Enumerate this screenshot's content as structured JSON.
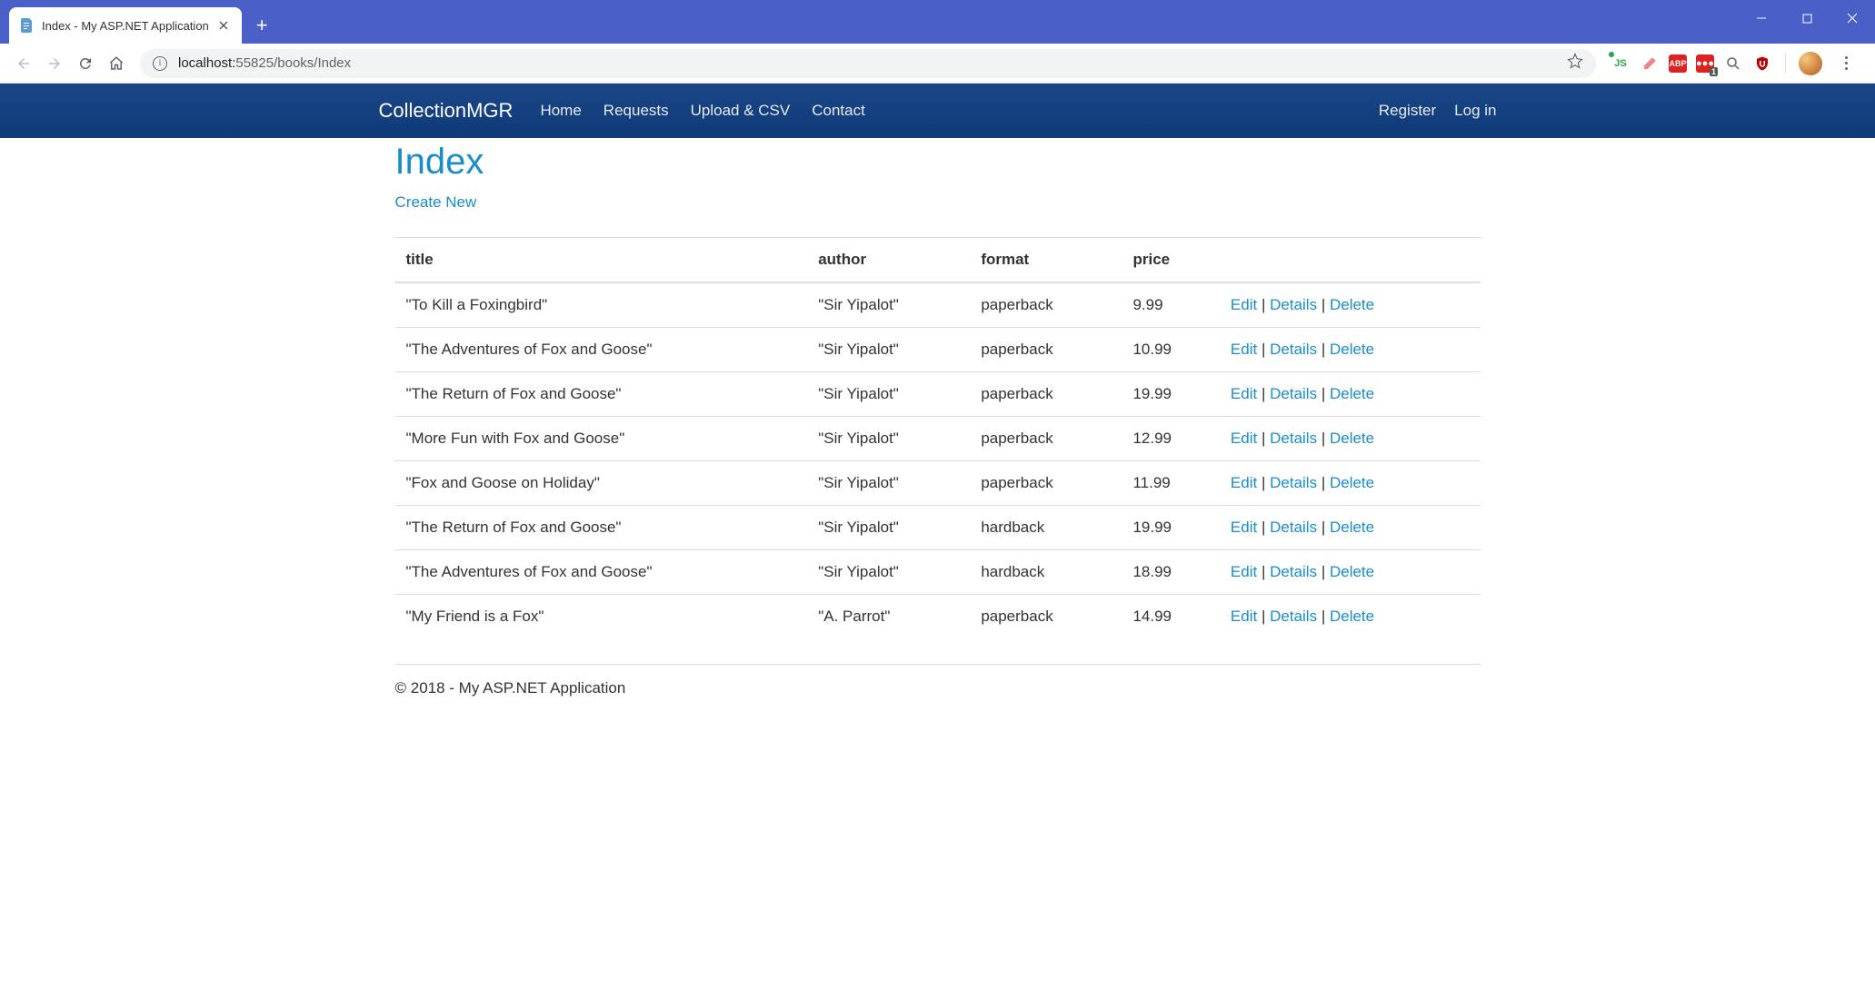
{
  "browser": {
    "tab_title": "Index - My ASP.NET Application",
    "url_host": "localhost:",
    "url_port": "55825",
    "url_path": "/books/Index"
  },
  "nav": {
    "brand": "CollectionMGR",
    "links": [
      "Home",
      "Requests",
      "Upload & CSV",
      "Contact"
    ],
    "right": [
      "Register",
      "Log in"
    ]
  },
  "page": {
    "title": "Index",
    "create_label": "Create New"
  },
  "table": {
    "headers": [
      "title",
      "author",
      "format",
      "price"
    ],
    "rows": [
      {
        "title": "\"To Kill a Foxingbird\"",
        "author": "\"Sir Yipalot\"",
        "format": "paperback",
        "price": "9.99"
      },
      {
        "title": "\"The Adventures of Fox and Goose\"",
        "author": "\"Sir Yipalot\"",
        "format": "paperback",
        "price": "10.99"
      },
      {
        "title": "\"The Return of Fox and Goose\"",
        "author": "\"Sir Yipalot\"",
        "format": "paperback",
        "price": "19.99"
      },
      {
        "title": "\"More Fun with Fox and Goose\"",
        "author": "\"Sir Yipalot\"",
        "format": "paperback",
        "price": "12.99"
      },
      {
        "title": "\"Fox and Goose on Holiday\"",
        "author": "\"Sir Yipalot\"",
        "format": "paperback",
        "price": "11.99"
      },
      {
        "title": "\"The Return of Fox and Goose\"",
        "author": "\"Sir Yipalot\"",
        "format": "hardback",
        "price": "19.99"
      },
      {
        "title": "\"The Adventures of Fox and Goose\"",
        "author": "\"Sir Yipalot\"",
        "format": "hardback",
        "price": "18.99"
      },
      {
        "title": "\"My Friend is a Fox\"",
        "author": "\"A. Parrot\"",
        "format": "paperback",
        "price": "14.99"
      }
    ],
    "actions": {
      "edit": "Edit",
      "details": "Details",
      "delete": "Delete"
    }
  },
  "footer": "© 2018 - My ASP.NET Application"
}
